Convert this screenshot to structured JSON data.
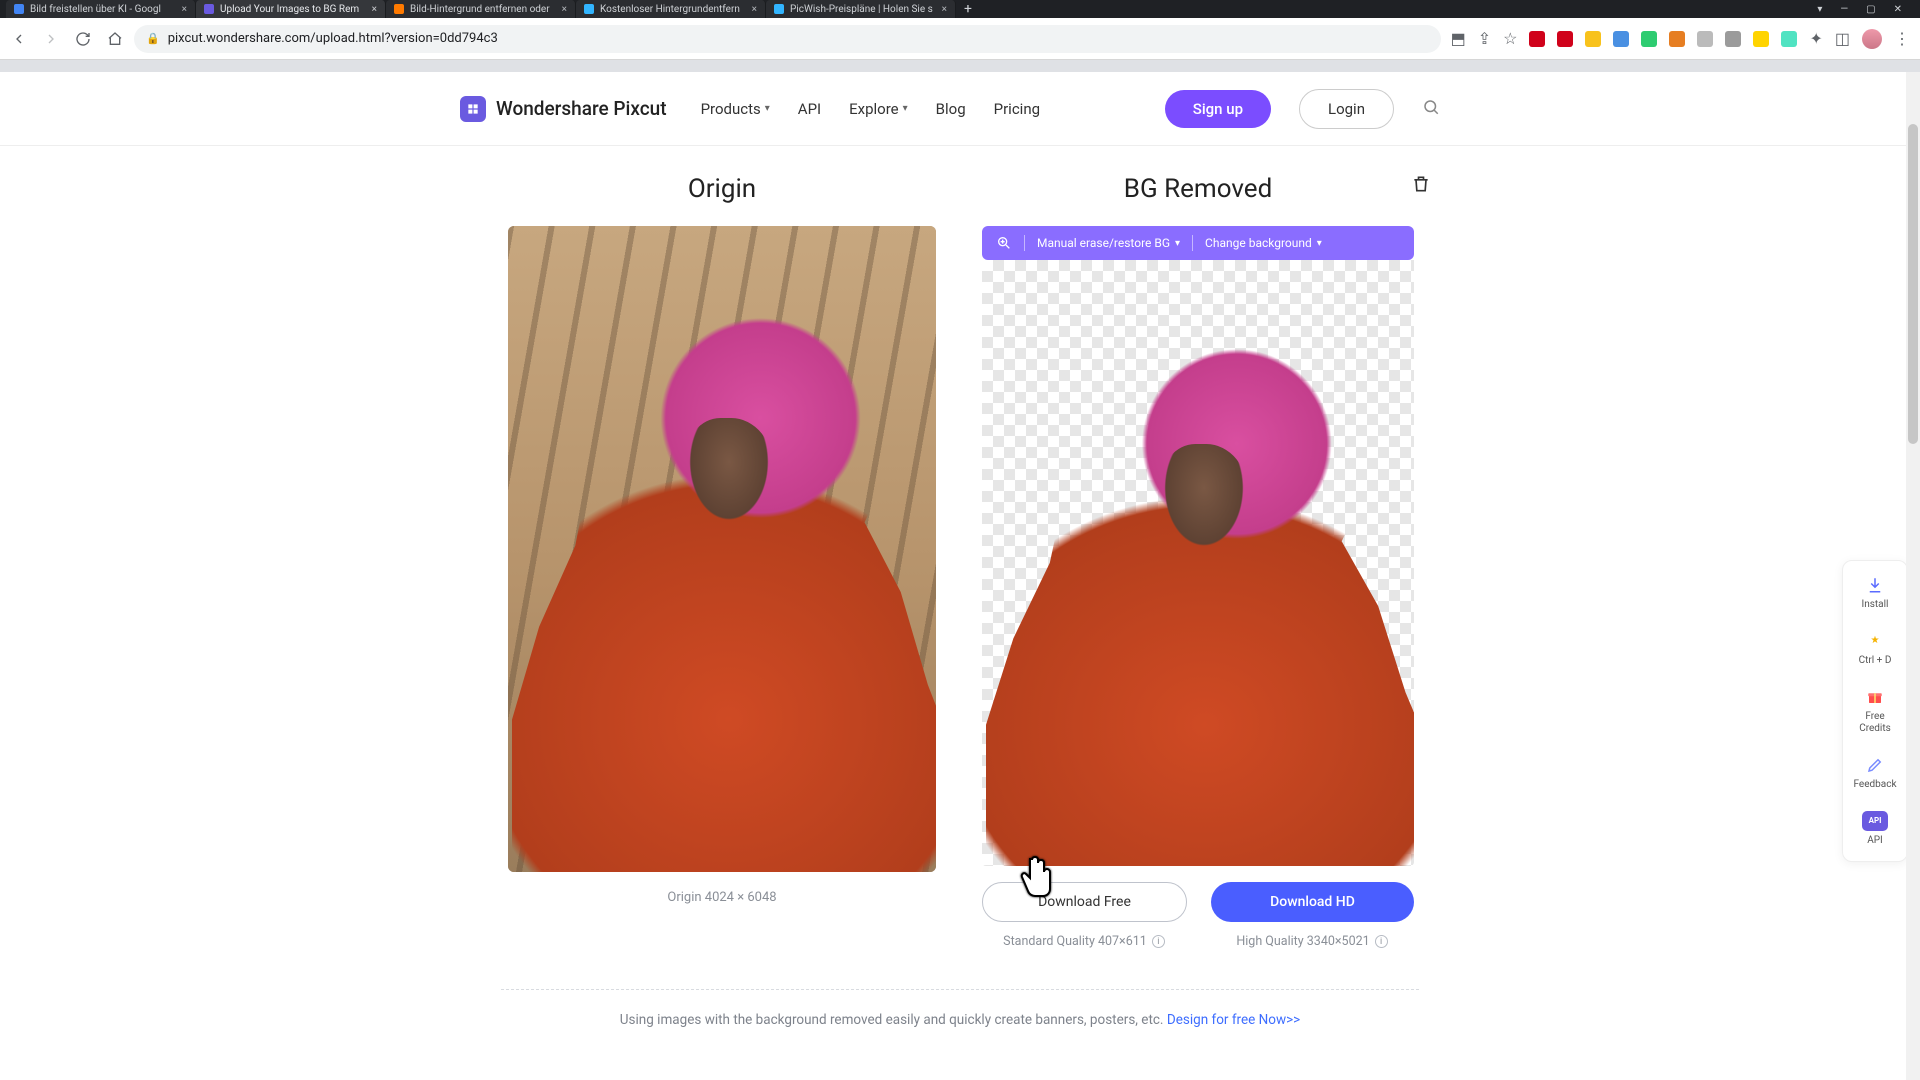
{
  "browser": {
    "tabs": [
      {
        "title": "Bild freistellen über KI - Googl",
        "favicon": "#4285f4"
      },
      {
        "title": "Upload Your Images to BG Rem",
        "favicon": "#6a5ae0",
        "active": true
      },
      {
        "title": "Bild-Hintergrund entfernen oder",
        "favicon": "#ff7a00"
      },
      {
        "title": "Kostenloser Hintergrundentfern",
        "favicon": "#32b5ff"
      },
      {
        "title": "PicWish-Preispläne | Holen Sie s",
        "favicon": "#32b5ff"
      }
    ],
    "url": "pixcut.wondershare.com/upload.html?version=0dd794c3",
    "ext_colors": [
      "#d0021b",
      "#d0021b",
      "#f8e71c",
      "#4a90e2",
      "#2ecc71",
      "#e67e22",
      "#bbbbbb",
      "#9b9b9b",
      "#ffd400",
      "#50e3c2",
      "#555555",
      "#444444",
      "#888888"
    ]
  },
  "header": {
    "brand": "Wondershare Pixcut",
    "nav": {
      "products": "Products",
      "api": "API",
      "explore": "Explore",
      "blog": "Blog",
      "pricing": "Pricing"
    },
    "signup": "Sign up",
    "login": "Login"
  },
  "panel": {
    "origin_title": "Origin",
    "removed_title": "BG Removed",
    "toolbar": {
      "manual": "Manual erase/restore BG",
      "change_bg": "Change background"
    },
    "origin_caption": "Origin 4024 × 6048",
    "download_free": "Download Free",
    "download_hd": "Download HD",
    "std_quality": "Standard Quality 407×611",
    "high_quality": "High Quality 3340×5021"
  },
  "footer": {
    "text": "Using images with the background removed easily and quickly create banners, posters, etc. ",
    "link": "Design for free Now>>"
  },
  "rail": {
    "install": "Install",
    "shortcut": "Ctrl + D",
    "credits1": "Free",
    "credits2": "Credits",
    "feedback": "Feedback",
    "api": "API"
  }
}
